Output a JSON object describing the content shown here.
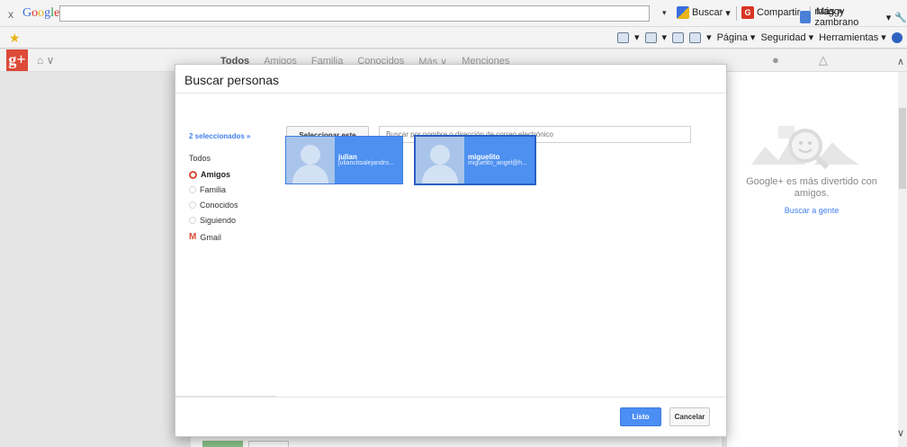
{
  "google_toolbar": {
    "close": "x",
    "logo": [
      "G",
      "o",
      "o",
      "g",
      "l",
      "e"
    ],
    "search_value": "",
    "buscar": "Buscar",
    "compartir": "Compartir",
    "mas": "Más »",
    "user_name": "maggy zambrano"
  },
  "ie_bar": {
    "pagina": "Página ▾",
    "seguridad": "Seguridad ▾",
    "herramientas": "Herramientas ▾"
  },
  "gplus_bar": {
    "logo": "g+",
    "tabs": [
      "Todos",
      "Amigos",
      "Familia",
      "Conocidos",
      "Más ∨",
      "Menciones"
    ]
  },
  "modal": {
    "title": "Buscar personas",
    "selected_count": "2 seleccionados »",
    "select_circle_button": "Seleccionar este círculo",
    "search_placeholder": "Buscar por nombre o dirección de correo electrónico",
    "sidebar": {
      "all": "Todos",
      "circles": [
        {
          "label": "Amigos",
          "active": true
        },
        {
          "label": "Familia",
          "active": false
        },
        {
          "label": "Conocidos",
          "active": false
        },
        {
          "label": "Siguiendo",
          "active": false
        }
      ],
      "gmail": "Gmail"
    },
    "people": [
      {
        "name": "julian",
        "email": "juliancitoalejandro..."
      },
      {
        "name": "miguelito",
        "email": "miguelito_angel@h..."
      }
    ],
    "done_button": "Listo",
    "cancel_button": "Cancelar"
  },
  "right_panel": {
    "message": "Google+ es más divertido con amigos.",
    "link": "Buscar a gente"
  },
  "colors": {
    "accent_blue": "#427fed",
    "gplus_red": "#dd4b39",
    "card_blue": "#4d90f0"
  }
}
